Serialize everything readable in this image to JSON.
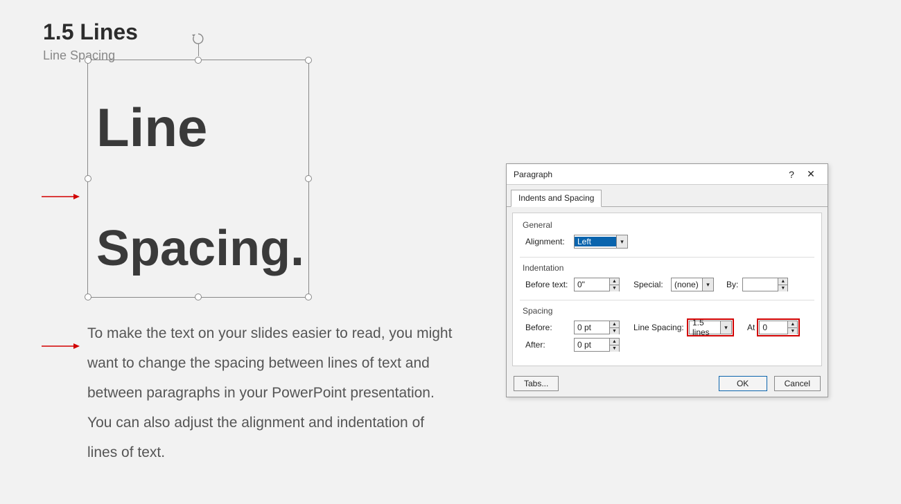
{
  "page": {
    "title": "1.5 Lines",
    "subtitle": "Line Spacing",
    "textbox_line1": "Line",
    "textbox_line2": "Spacing.",
    "body_paragraph": "To make the text on your slides easier to read, you might want to change the spacing between lines of text and between paragraphs in your PowerPoint presentation. You can also adjust the alignment and indentation of lines of text."
  },
  "dialog": {
    "title": "Paragraph",
    "help_glyph": "?",
    "close_glyph": "✕",
    "tab_label": "Indents and Spacing",
    "groups": {
      "general": {
        "title": "General",
        "alignment_label": "Alignment:",
        "alignment_value": "Left"
      },
      "indentation": {
        "title": "Indentation",
        "before_text_label": "Before text:",
        "before_text_value": "0\"",
        "special_label": "Special:",
        "special_value": "(none)",
        "by_label": "By:",
        "by_value": ""
      },
      "spacing": {
        "title": "Spacing",
        "before_label": "Before:",
        "before_value": "0 pt",
        "after_label": "After:",
        "after_value": "0 pt",
        "line_spacing_label": "Line Spacing:",
        "line_spacing_value": "1.5 lines",
        "at_label": "At",
        "at_value": "0"
      }
    },
    "buttons": {
      "tabs": "Tabs...",
      "ok": "OK",
      "cancel": "Cancel"
    }
  }
}
